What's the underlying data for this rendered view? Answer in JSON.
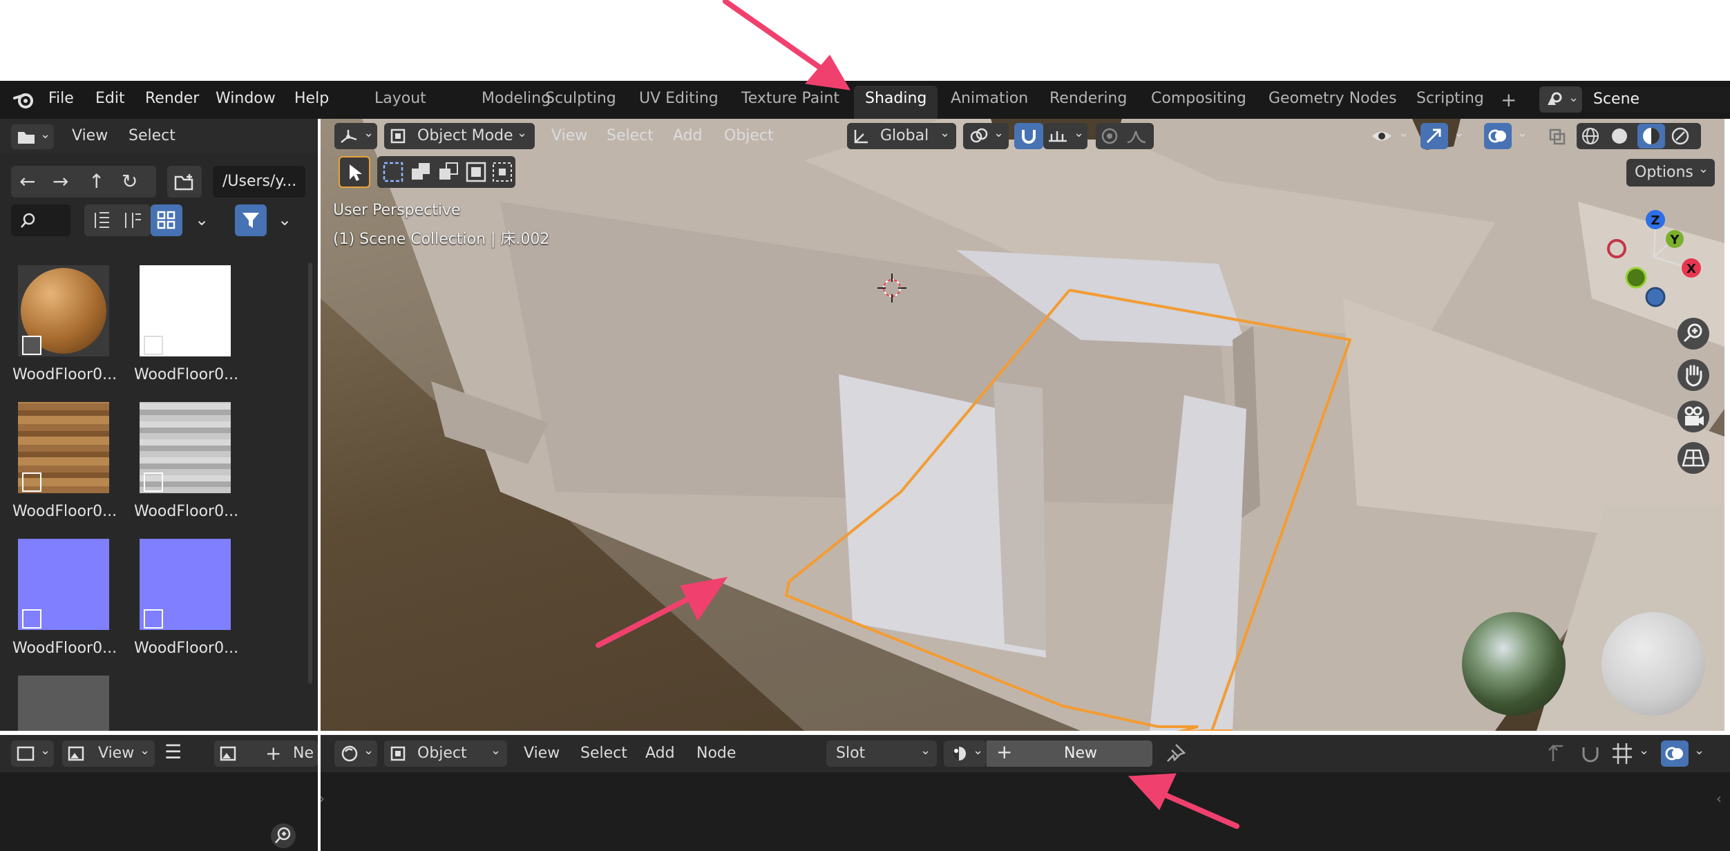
{
  "menu": {
    "file": "File",
    "edit": "Edit",
    "render": "Render",
    "window": "Window",
    "help": "Help"
  },
  "workspaces": [
    "Layout",
    "Modeling",
    "Sculpting",
    "UV Editing",
    "Texture Paint",
    "Shading",
    "Animation",
    "Rendering",
    "Compositing",
    "Geometry Nodes",
    "Scripting"
  ],
  "active_workspace": "Shading",
  "scene": "Scene",
  "file_browser": {
    "view_label": "View",
    "select_label": "Select",
    "path": "/Users/y...",
    "thumbnails": [
      {
        "label": "WoodFloor0...",
        "icon": "sphere-wood-thumb"
      },
      {
        "label": "WoodFloor0...",
        "icon": "white-thumb"
      },
      {
        "label": "WoodFloor0...",
        "icon": "wood-thumb"
      },
      {
        "label": "WoodFloor0...",
        "icon": "gray-thumb"
      },
      {
        "label": "WoodFloor0...",
        "icon": "normal-thumb"
      },
      {
        "label": "WoodFloor0...",
        "icon": "normal-thumb"
      }
    ]
  },
  "viewport": {
    "mode": "Object Mode",
    "view": "View",
    "select": "Select",
    "add": "Add",
    "object": "Object",
    "orientation": "Global",
    "options": "Options",
    "overlay_line1": "User Perspective",
    "overlay_line2": "(1) Scene Collection | 床.002"
  },
  "image_editor": {
    "view": "View",
    "new_partial": "Ne"
  },
  "node_editor": {
    "type": "Object",
    "view": "View",
    "select": "Select",
    "add": "Add",
    "node": "Node",
    "slot": "Slot",
    "new": "New"
  },
  "colors": {
    "accent": "#4772b3",
    "selection": "#f39c33",
    "arrow": "#f0416e"
  }
}
